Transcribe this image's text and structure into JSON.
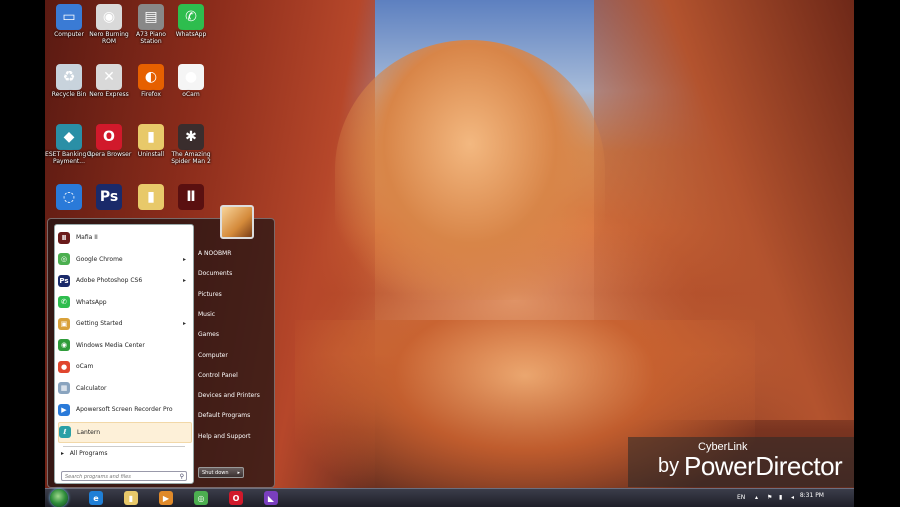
{
  "desktop": {
    "icons": [
      {
        "label": "Computer",
        "icon": "computer-icon",
        "color": "#3a7bd5",
        "glyph": "▭"
      },
      {
        "label": "Nero Burning ROM",
        "icon": "nero-burning-rom-icon",
        "color": "#d9d9d9",
        "glyph": "◉"
      },
      {
        "label": "A73 Piano Station",
        "icon": "piano-station-icon",
        "color": "#888888",
        "glyph": "▤"
      },
      {
        "label": "WhatsApp",
        "icon": "whatsapp-icon",
        "color": "#2ebd4e",
        "glyph": "✆"
      },
      {
        "label": "Recycle Bin",
        "icon": "recycle-bin-icon",
        "color": "#c8d3dc",
        "glyph": "♻"
      },
      {
        "label": "Nero Express",
        "icon": "nero-express-icon",
        "color": "#d9d9d9",
        "glyph": "✕"
      },
      {
        "label": "Firefox",
        "icon": "firefox-icon",
        "color": "#e66000",
        "glyph": "◐"
      },
      {
        "label": "oCam",
        "icon": "ocam-icon",
        "color": "#f5f5f5",
        "glyph": "●"
      },
      {
        "label": "ESET Banking & Payment...",
        "icon": "eset-banking-icon",
        "color": "#2a8fa6",
        "glyph": "◆"
      },
      {
        "label": "Opera Browser",
        "icon": "opera-icon",
        "color": "#d1192b",
        "glyph": "O"
      },
      {
        "label": "Uninstall",
        "icon": "uninstall-folder-icon",
        "color": "#e8c96a",
        "glyph": "▮"
      },
      {
        "label": "The Amazing Spider Man 2",
        "icon": "spider-man-game-icon",
        "color": "#3a2d2d",
        "glyph": "✱"
      },
      {
        "label": "",
        "icon": "file-icon",
        "color": "#2a7ad9",
        "glyph": "◌"
      },
      {
        "label": "",
        "icon": "photoshop-icon",
        "color": "#1a2a6a",
        "glyph": "Ps"
      },
      {
        "label": "",
        "icon": "folder-icon",
        "color": "#e8c96a",
        "glyph": "▮"
      },
      {
        "label": "",
        "icon": "mafia-game-icon",
        "color": "#5a1010",
        "glyph": "Ⅱ"
      }
    ]
  },
  "start_menu": {
    "programs": [
      {
        "label": "Mafia II",
        "icon": "mafia-icon",
        "color": "#6a1a1a",
        "glyph": "Ⅱ",
        "arrow": ""
      },
      {
        "label": "Google Chrome",
        "icon": "chrome-icon",
        "color": "#4caf50",
        "glyph": "◎",
        "arrow": "▸"
      },
      {
        "label": "Adobe Photoshop CS6",
        "icon": "photoshop-icon",
        "color": "#1a2a6a",
        "glyph": "Ps",
        "arrow": "▸"
      },
      {
        "label": "WhatsApp",
        "icon": "whatsapp-icon",
        "color": "#2ebd4e",
        "glyph": "✆",
        "arrow": ""
      },
      {
        "label": "Getting Started",
        "icon": "getting-started-icon",
        "color": "#d9a13a",
        "glyph": "▣",
        "arrow": "▸"
      },
      {
        "label": "Windows Media Center",
        "icon": "media-center-icon",
        "color": "#2f9c3a",
        "glyph": "◉",
        "arrow": ""
      },
      {
        "label": "oCam",
        "icon": "ocam-icon",
        "color": "#e0462e",
        "glyph": "●",
        "arrow": ""
      },
      {
        "label": "Calculator",
        "icon": "calculator-icon",
        "color": "#8aa4bf",
        "glyph": "▦",
        "arrow": ""
      },
      {
        "label": "Apowersoft Screen Recorder Pro",
        "icon": "screen-recorder-icon",
        "color": "#2a7ad9",
        "glyph": "▶",
        "arrow": ""
      },
      {
        "label": "Lantern",
        "icon": "lantern-icon",
        "color": "#2aa0a6",
        "glyph": "ℓ",
        "arrow": ""
      }
    ],
    "all_programs": "All Programs",
    "search_placeholder": "Search programs and files",
    "right_items": [
      "A NOOBMR",
      "Documents",
      "Pictures",
      "Music",
      "Games",
      "Computer",
      "Control Panel",
      "Devices and Printers",
      "Default Programs",
      "Help and Support"
    ],
    "shutdown_label": "Shut down"
  },
  "taskbar": {
    "pinned": [
      {
        "icon": "internet-explorer-icon",
        "color": "#1f7fd6",
        "glyph": "e"
      },
      {
        "icon": "explorer-folder-icon",
        "color": "#e8c96a",
        "glyph": "▮"
      },
      {
        "icon": "media-player-icon",
        "color": "#e08a2a",
        "glyph": "▶"
      },
      {
        "icon": "chrome-icon",
        "color": "#4caf50",
        "glyph": "◎"
      },
      {
        "icon": "opera-icon",
        "color": "#d1192b",
        "glyph": "O"
      },
      {
        "icon": "visual-studio-icon",
        "color": "#7a3fbf",
        "glyph": "◣"
      }
    ],
    "language": "EN",
    "time": "8:31 PM"
  },
  "watermark": {
    "by": "by",
    "brand": "CyberLink",
    "product": "PowerDirector"
  }
}
